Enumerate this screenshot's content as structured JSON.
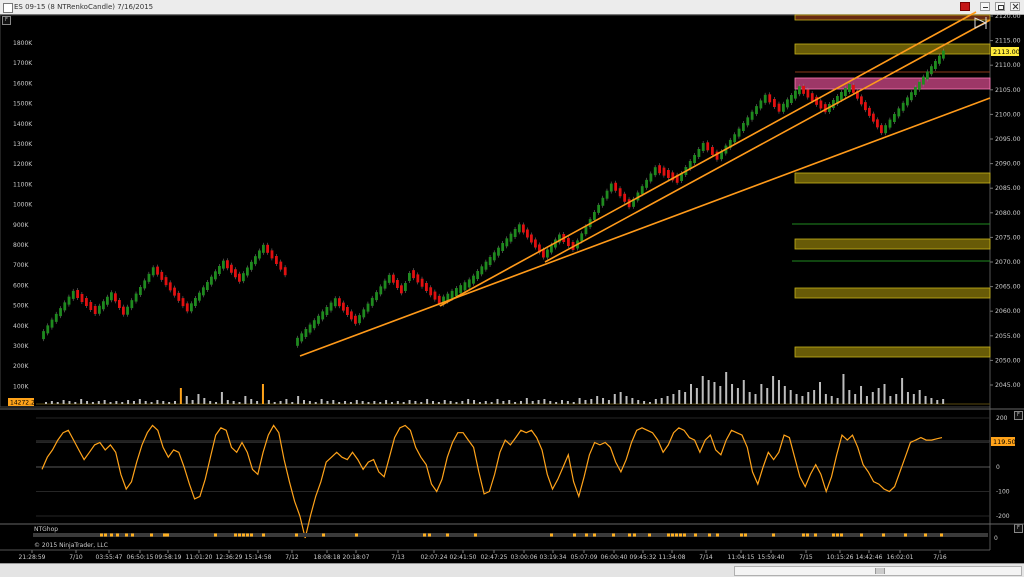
{
  "window": {
    "title": "ES 09-15 (8 NTRenkoCandle)  7/16/2015",
    "colors": {
      "titlebar": "#ececec",
      "background": "#000000",
      "accent_close": "#c41515"
    }
  },
  "price_panel": {
    "price_ticks": [
      "2120.00",
      "2115.00",
      "2110.00",
      "2105.00",
      "2100.00",
      "2095.00",
      "2090.00",
      "2085.00",
      "2080.00",
      "2075.00",
      "2070.00",
      "2065.00",
      "2060.00",
      "2055.00",
      "2050.00",
      "2045.00"
    ],
    "volume_ticks": [
      "1800K",
      "1700K",
      "1600K",
      "1500K",
      "1400K",
      "1300K",
      "1200K",
      "1100K",
      "1000K",
      "900K",
      "800K",
      "700K",
      "600K",
      "500K",
      "400K",
      "300K",
      "200K",
      "100K"
    ],
    "current_price_label": "2113.00",
    "volume_marker_label": "14272.2",
    "colors": {
      "up_candle": "#1f8a1f",
      "down_candle": "#e01010",
      "trendline": "#ff9a1a",
      "zone_gold": "#8b7a0a",
      "zone_pink": "#d24a8a",
      "volume": "#bdbdbd"
    }
  },
  "oscillator_panel": {
    "ticks": [
      "200",
      "100",
      "0",
      "-100",
      "-200"
    ],
    "current_value_label": "119.50",
    "line_color": "#ffa31a",
    "values": [
      -10,
      40,
      70,
      110,
      140,
      150,
      110,
      70,
      30,
      60,
      90,
      100,
      70,
      90,
      60,
      -30,
      -90,
      -60,
      20,
      90,
      140,
      170,
      150,
      80,
      40,
      70,
      60,
      0,
      -70,
      -130,
      -120,
      -50,
      40,
      130,
      160,
      150,
      80,
      60,
      100,
      60,
      -10,
      -30,
      60,
      130,
      170,
      140,
      30,
      -60,
      -140,
      -200,
      -290,
      -200,
      -120,
      -60,
      20,
      40,
      60,
      40,
      30,
      60,
      30,
      -10,
      20,
      30,
      -20,
      -40,
      40,
      120,
      160,
      170,
      150,
      80,
      40,
      10,
      -70,
      -100,
      -50,
      40,
      100,
      140,
      140,
      110,
      80,
      -20,
      -110,
      -100,
      -30,
      60,
      110,
      90,
      120,
      150,
      140,
      150,
      120,
      70,
      -30,
      -90,
      -50,
      0,
      50,
      -60,
      -120,
      -40,
      50,
      100,
      90,
      100,
      80,
      20,
      -20,
      30,
      100,
      150,
      160,
      150,
      140,
      110,
      60,
      90,
      140,
      160,
      150,
      120,
      110,
      60,
      110,
      130,
      70,
      50,
      110,
      150,
      140,
      130,
      80,
      -20,
      -70,
      0,
      60,
      30,
      60,
      130,
      120,
      40,
      -40,
      -80,
      -30,
      10,
      -30,
      -100,
      -40,
      50,
      130,
      110,
      130,
      80,
      10,
      -20,
      -60,
      -70,
      -90,
      -100,
      -80,
      -20,
      40,
      100,
      110,
      120,
      110,
      110,
      115,
      120
    ]
  },
  "status_panel": {
    "label": "NTGhop",
    "copyright": "© 2015 NinjaTrader, LLC"
  },
  "time_axis": {
    "labels": [
      "21:28:59",
      "7/10",
      "03:55:47",
      "06:50:15",
      "09:58:19",
      "11:01:20",
      "12:36:29",
      "15:14:58",
      "7/12",
      "18:08:18",
      "20:18:07",
      "7/13",
      "02:07:24",
      "02:41:50",
      "02:47:25",
      "03:00:06",
      "03:19:34",
      "05:07:09",
      "06:00:40",
      "09:45:32",
      "11:34:08",
      "7/14",
      "11:04:15",
      "15:59:40",
      "7/15",
      "10:15:26",
      "14:42:46",
      "16:02:01",
      "7/16"
    ]
  },
  "tabs": {
    "price_tab": "F",
    "osc_tab": "F",
    "status_tab": "F"
  }
}
